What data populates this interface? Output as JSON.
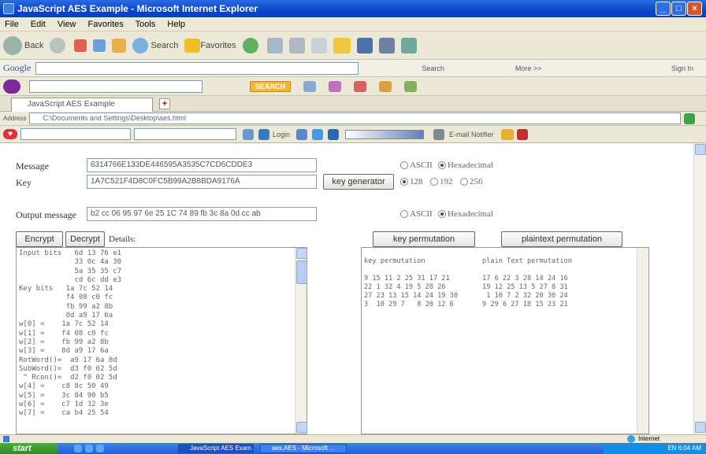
{
  "window": {
    "title": "JavaScript AES Example - Microsoft Internet Explorer"
  },
  "menu": [
    "File",
    "Edit",
    "View",
    "Favorites",
    "Tools",
    "Help"
  ],
  "toolbar": {
    "back": "Back",
    "search": "Search",
    "favorites": "Favorites"
  },
  "google_bar": {
    "logo": "Google",
    "search_label": "Search",
    "more": "More >>",
    "signin": "Sign In"
  },
  "yahoo_bar": {
    "search_button": "SEARCH"
  },
  "tab": {
    "title": "JavaScript AES Example"
  },
  "address": {
    "label": "Address",
    "url": "C:\\Documents and Settings\\Desktop\\aes.html"
  },
  "links_bar": {
    "login": "Login",
    "email_notifier": "E-mail Notifier"
  },
  "form": {
    "message_label": "Message",
    "message_value": "6314766E133DE446595A3535C7CD6CDDE3",
    "key_label": "Key",
    "key_value": "1A7C521F4D8C0FC5B99A2B8BDA9176A",
    "output_label": "Output message",
    "output_value": "b2 cc 06 95 97 6e 25 1C 74 89 fb 3c 8a 0d cc ab",
    "ascii": "ASCII",
    "hexadecimal": "Hexadecimal",
    "key_generator": "key generator",
    "key_sizes": [
      "128",
      "192",
      "256"
    ]
  },
  "buttons": {
    "encrypt": "Encrypt",
    "decrypt": "Decrypt",
    "details": "Details:",
    "key_permutation": "key permutation",
    "plaintext_permutation": "plaintext permutation"
  },
  "details_text": "Input bits   6d 13 76 e1\n             33 0c 4a 30\n             5a 35 35 c7\n             cd 6c dd e3\nKey bits   1a 7c 52 14\n           f4 08 c0 fc\n           fb 99 a2 8b\n           8d a9 17 6a\nw[0] =    1a 7c 52 14\nw[1] =    f4 08 c0 fc\nw[2] =    fb 99 a2 8b\nw[3] =    8d a9 17 6a\nRotWord()=  a9 17 6a 8d\nSubWord()=  d3 f0 02 5d\n ^ Rcon()=  d2 f0 02 5d\nw[4] =    c8 8c 50 49\nw[5] =    3c 84 90 b5\nw[6] =    c7 1d 32 3e\nw[7] =    ca b4 25 54",
  "permutation_text": "key permutation              plain Text permutation\n\n9 15 11 2 25 31 17 21        17 6 22 3 28 14 24 16\n22 1 32 4 19 5 28 26         19 12 25 13 5 27 8 31\n27 23 13 15 14 24 19 30       1 10 7 2 32 20 30 24\n3  10 29 7   8 20 12 6       9 29 6 27 18 15 23 21",
  "status": {
    "zone": "Internet"
  },
  "taskbar": {
    "start": "start",
    "tasks": [
      "JavaScript AES Exam...",
      "aes.AES - Microsoft ..."
    ],
    "tray": "EN  6:04 AM"
  }
}
